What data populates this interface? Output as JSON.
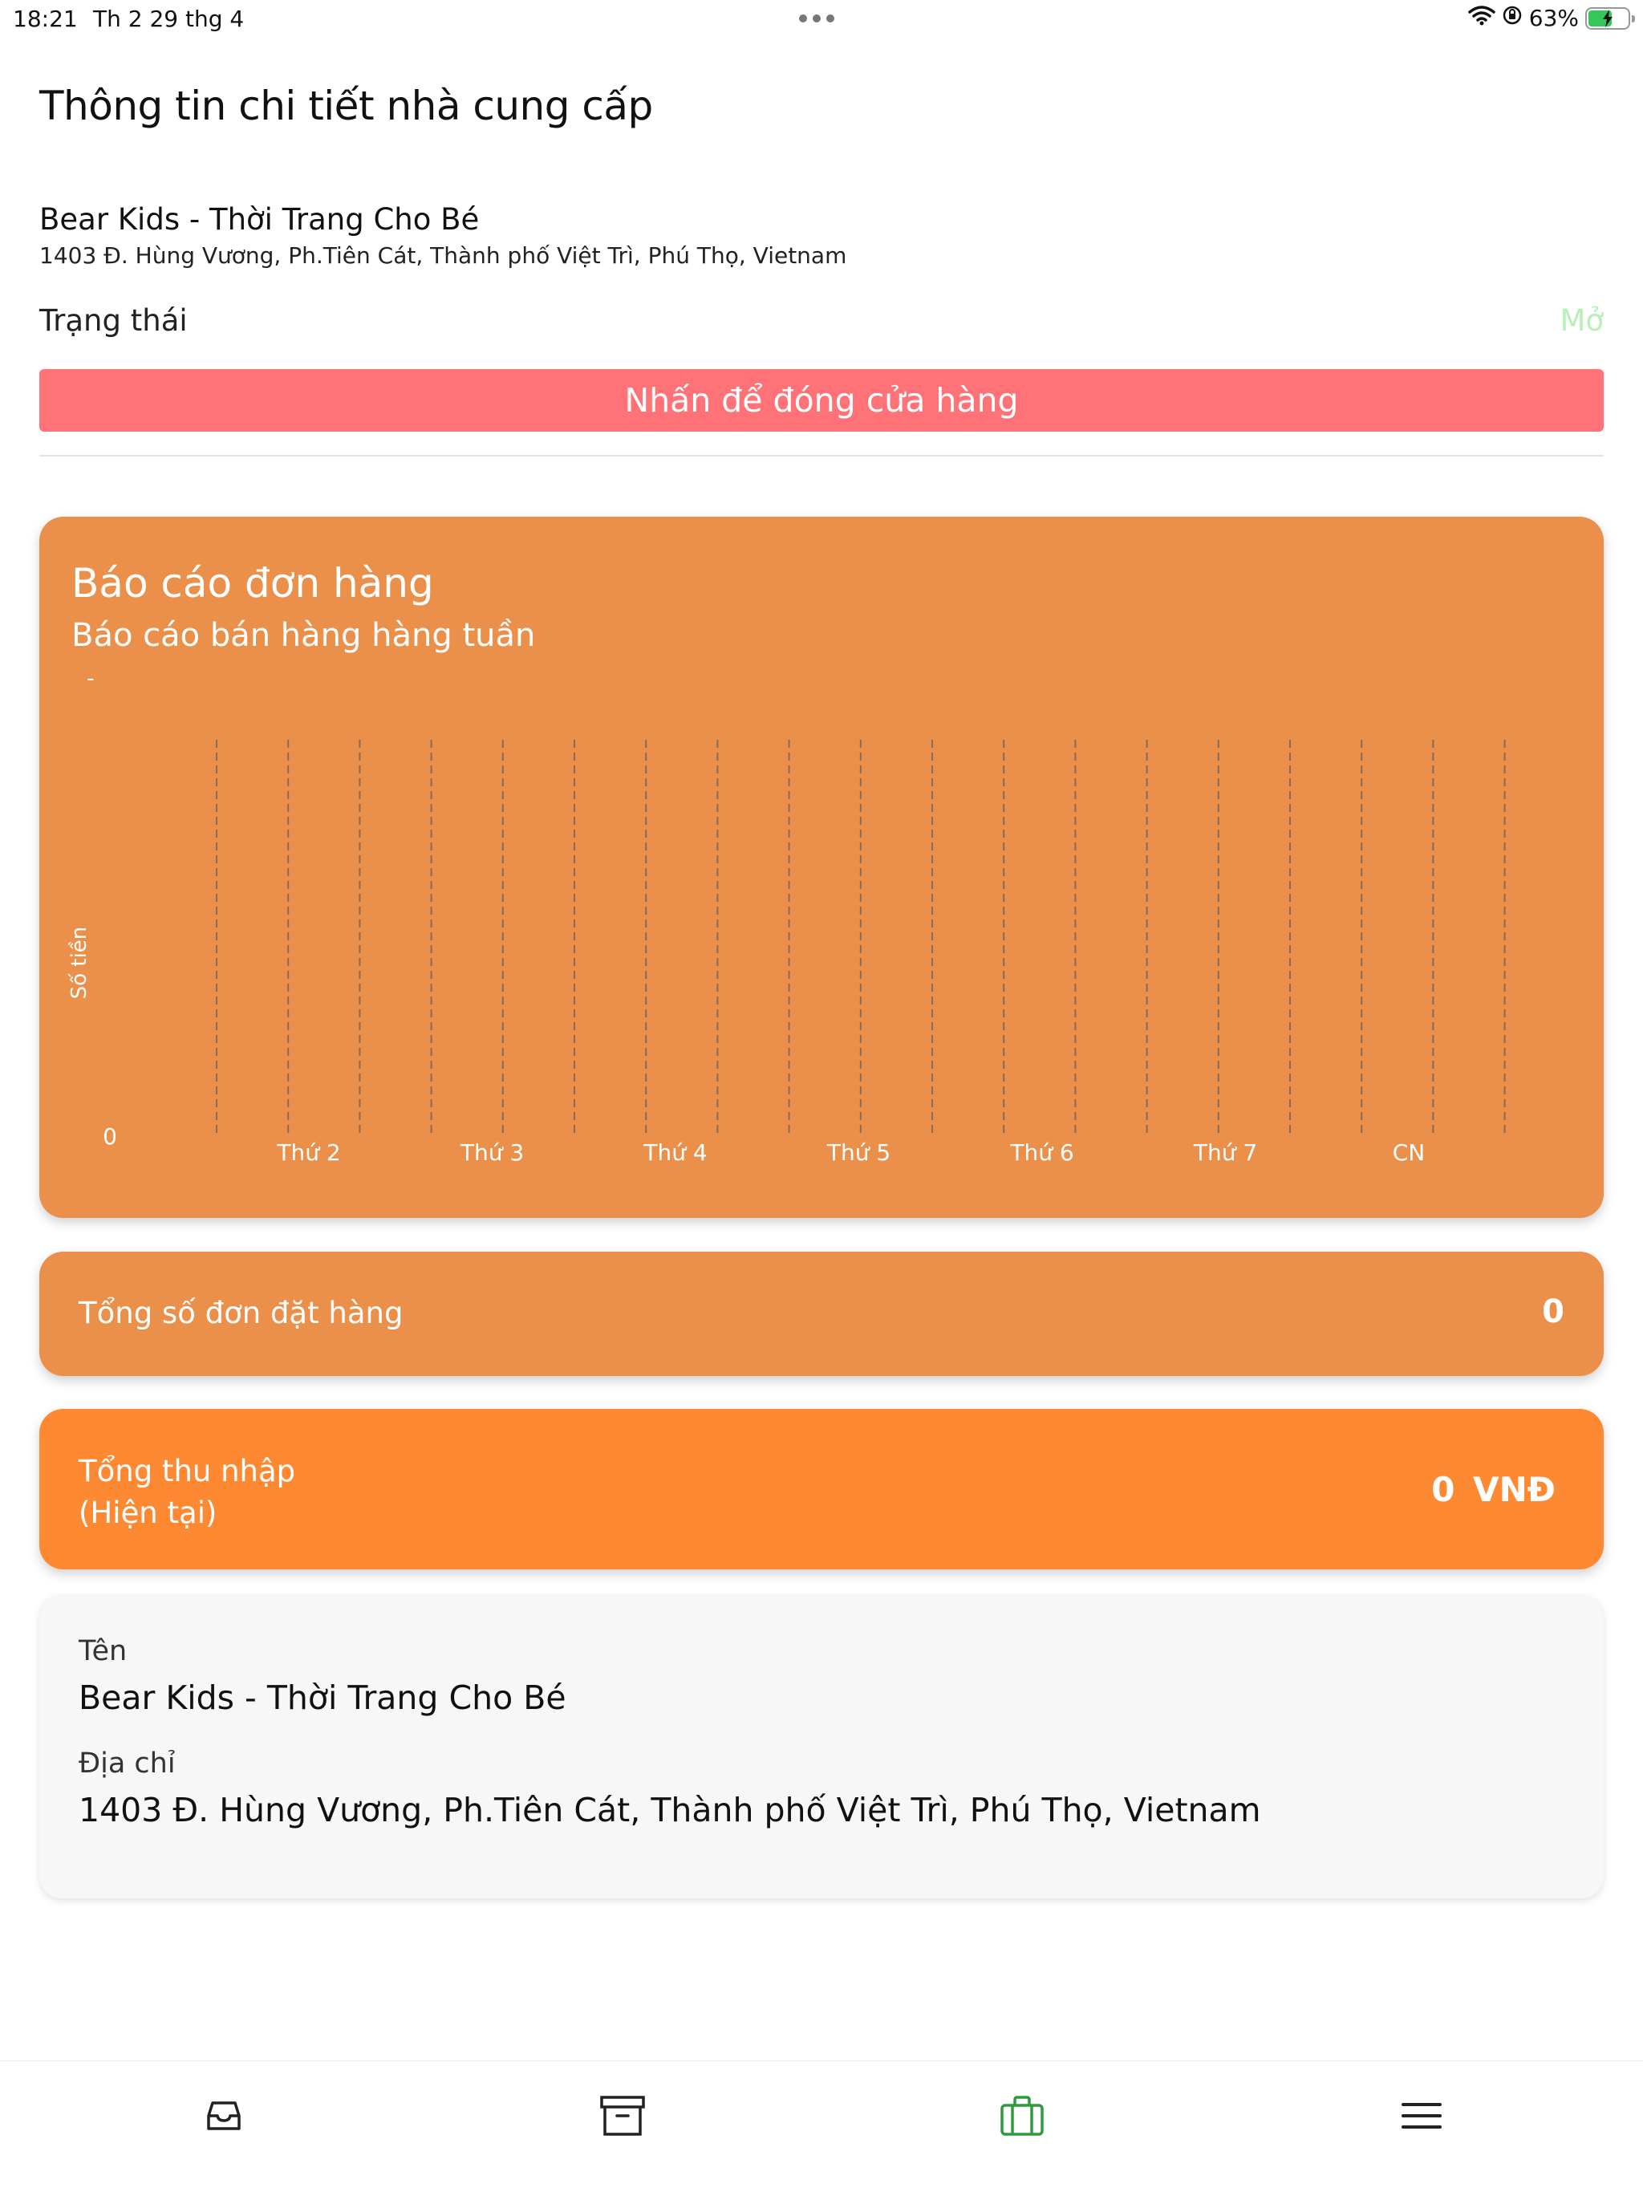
{
  "status_bar": {
    "time": "18:21",
    "date": "Th 2 29 thg 4",
    "battery": "63%",
    "battery_level": 0.63
  },
  "header": {
    "title": "Thông tin chi tiết nhà cung cấp",
    "store_name": "Bear Kids - Thời Trang Cho Bé",
    "store_address": "1403 Đ. Hùng Vương, Ph.Tiên Cát, Thành phố Việt Trì, Phú Thọ, Vietnam"
  },
  "status": {
    "label": "Trạng thái",
    "value": "Mở",
    "close_button_label": "Nhấn để đóng cửa hàng"
  },
  "report": {
    "title": "Báo cáo đơn hàng",
    "subtitle": "Báo cáo bán hàng hàng tuần"
  },
  "chart_data": {
    "type": "bar",
    "title": "",
    "xlabel": "",
    "ylabel": "Số tiền",
    "top_tick_label": "-",
    "y_tick_labels": [
      "0"
    ],
    "categories": [
      "Thứ 2",
      "Thứ 3",
      "Thứ 4",
      "Thứ 5",
      "Thứ 6",
      "Thứ 7",
      "CN"
    ],
    "values": [
      0,
      0,
      0,
      0,
      0,
      0,
      0
    ],
    "grid": "vertical dashed"
  },
  "orders": {
    "label": "Tổng số đơn đặt hàng",
    "value": "0"
  },
  "income": {
    "label_line1": "Tổng thu nhập",
    "label_line2": "(Hiện tại)",
    "value": "0 VNĐ"
  },
  "info": {
    "name_label": "Tên",
    "name_value": "Bear Kids - Thời Trang Cho Bé",
    "address_label": "Địa chỉ",
    "address_value": "1403 Đ. Hùng Vương, Ph.Tiên Cát, Thành phố Việt Trì, Phú Thọ, Vietnam"
  },
  "tabs": [
    {
      "icon": "inbox-icon",
      "active": false
    },
    {
      "icon": "archive-box-icon",
      "active": false
    },
    {
      "icon": "briefcase-icon",
      "active": true
    },
    {
      "icon": "menu-icon",
      "active": false
    }
  ],
  "colors": {
    "card_orange": "#ea904a",
    "income_orange": "#fd8a33",
    "close_button_red": "#ff7278",
    "status_open_green": "#b6f0b6",
    "active_tab_green": "#2e9a3e"
  }
}
